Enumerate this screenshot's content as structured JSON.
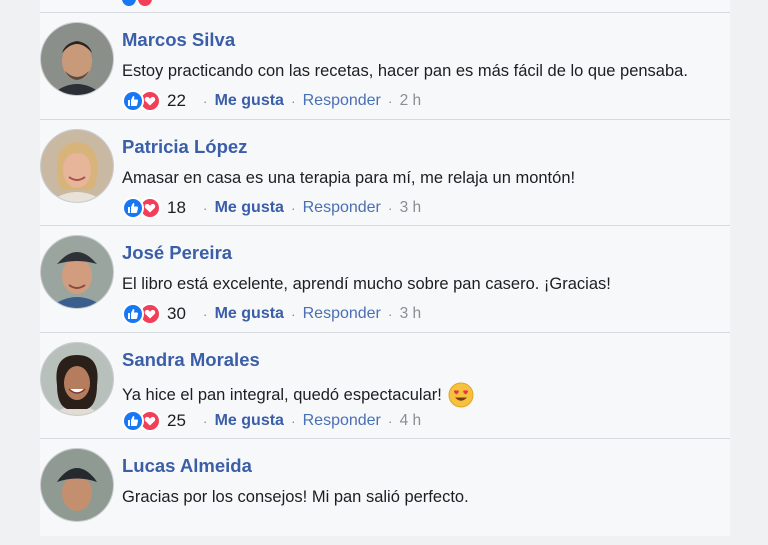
{
  "comments": [
    {
      "name": "Marcos Silva",
      "text": "Estoy practicando con las recetas, hacer pan es más fácil de lo que pensaba.",
      "reactions": "22",
      "like_label": "Me gusta",
      "reply_label": "Responder",
      "time": "2 h",
      "emoji": ""
    },
    {
      "name": "Patricia López",
      "text": "Amasar en casa es una terapia para mí, me relaja un montón!",
      "reactions": "18",
      "like_label": "Me gusta",
      "reply_label": "Responder",
      "time": "3 h",
      "emoji": ""
    },
    {
      "name": "José Pereira",
      "text": "El libro está excelente, aprendí mucho sobre pan casero. ¡Gracias!",
      "reactions": "30",
      "like_label": "Me gusta",
      "reply_label": "Responder",
      "time": "3 h",
      "emoji": ""
    },
    {
      "name": "Sandra Morales",
      "text": "Ya hice el pan integral, quedó espectacular!",
      "reactions": "25",
      "like_label": "Me gusta",
      "reply_label": "Responder",
      "time": "4 h",
      "emoji": "heart-eyes-emoji"
    },
    {
      "name": "Lucas Almeida",
      "text": "Gracias por los consejos! Mi pan salió perfecto.",
      "reactions": "",
      "like_label": "",
      "reply_label": "",
      "time": "",
      "emoji": ""
    }
  ],
  "icons": {
    "like": "thumbs-up-icon",
    "love": "heart-icon"
  },
  "colors": {
    "name": "#3b5ea8",
    "like_blue": "#1877f2",
    "love_red": "#f33e58",
    "separator": "#d6d9de"
  }
}
